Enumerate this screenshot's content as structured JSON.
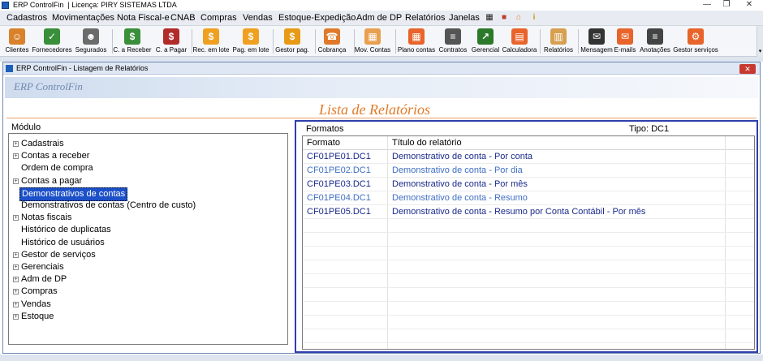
{
  "window": {
    "title": "ERP ControlFin",
    "license": "| Licença: PIRY SISTEMAS LTDA",
    "controls": {
      "minimize": "—",
      "restore": "❐",
      "close": "✕"
    }
  },
  "menu": {
    "items": [
      "Cadastros",
      "Movimentações",
      "Nota Fiscal-e",
      "CNAB",
      "Compras",
      "Vendas",
      "Estoque-Expedição",
      "Adm de DP",
      "Relatórios",
      "Janelas"
    ],
    "icons": [
      "calculator-icon",
      "lock-icon",
      "home-icon",
      "info-icon"
    ]
  },
  "toolbar": {
    "buttons": [
      {
        "label": "Clientes",
        "icon": "clients-icon",
        "color": "#d9822b",
        "glyph": "☺"
      },
      {
        "label": "Fornecedores",
        "icon": "suppliers-icon",
        "color": "#3a8f3a",
        "glyph": "✓"
      },
      {
        "label": "Segurados",
        "icon": "insured-icon",
        "color": "#6b6b6b",
        "glyph": "☻"
      },
      {
        "label": "C. a Receber",
        "icon": "receivable-icon",
        "color": "#3a8f3a",
        "glyph": "$"
      },
      {
        "label": "C. a Pagar",
        "icon": "payable-icon",
        "color": "#b22b2b",
        "glyph": "$"
      },
      {
        "label": "Rec. em lote",
        "icon": "batch-receive-icon",
        "color": "#f0a020",
        "glyph": "$"
      },
      {
        "label": "Pag. em lote",
        "icon": "batch-pay-icon",
        "color": "#f0a020",
        "glyph": "$"
      },
      {
        "label": "Gestor pag.",
        "icon": "payment-manager-icon",
        "color": "#e89a16",
        "glyph": "$"
      },
      {
        "label": "Cobrança",
        "icon": "billing-phone-icon",
        "color": "#e07a2a",
        "glyph": "☎"
      },
      {
        "label": "Mov. Contas",
        "icon": "boxes-icon",
        "color": "#e8a050",
        "glyph": "▦"
      },
      {
        "label": "Plano contas",
        "icon": "chart-of-accounts-icon",
        "color": "#e8642a",
        "glyph": "▦"
      },
      {
        "label": "Contratos",
        "icon": "contracts-icon",
        "color": "#555555",
        "glyph": "≡"
      },
      {
        "label": "Gerencial",
        "icon": "management-chart-icon",
        "color": "#2b7a2b",
        "glyph": "↗"
      },
      {
        "label": "Calculadora",
        "icon": "calculator-icon",
        "color": "#e8642a",
        "glyph": "▤"
      },
      {
        "label": "Relatórios",
        "icon": "reports-icon",
        "color": "#d6a050",
        "glyph": "▥"
      },
      {
        "label": "Mensagem",
        "icon": "message-icon",
        "color": "#333333",
        "glyph": "✉"
      },
      {
        "label": "E-mails",
        "icon": "email-icon",
        "color": "#e8642a",
        "glyph": "✉"
      },
      {
        "label": "Anotações",
        "icon": "notes-icon",
        "color": "#444444",
        "glyph": "≡"
      },
      {
        "label": "Gestor serviços",
        "icon": "services-manager-icon",
        "color": "#e8642a",
        "glyph": "⚙"
      }
    ]
  },
  "child_window": {
    "title": "ERP ControlFin - Listagem de Relatórios",
    "close": "✕",
    "brand": "ERP ControlFin",
    "heading": "Lista de Relatórios"
  },
  "left_panel": {
    "label": "Módulo",
    "expand_glyph": "+",
    "tree": [
      {
        "label": "Cadastrais",
        "expandable": true,
        "selected": false
      },
      {
        "label": "Contas a receber",
        "expandable": true,
        "selected": false
      },
      {
        "label": "Ordem de compra",
        "expandable": false,
        "selected": false
      },
      {
        "label": "Contas a pagar",
        "expandable": true,
        "selected": false
      },
      {
        "label": "Demonstrativos de contas",
        "expandable": false,
        "selected": true
      },
      {
        "label": "Demonstrativos de contas (Centro de custo)",
        "expandable": false,
        "selected": false
      },
      {
        "label": "Notas fiscais",
        "expandable": true,
        "selected": false
      },
      {
        "label": "Histórico de duplicatas",
        "expandable": false,
        "selected": false
      },
      {
        "label": "Histórico de usuários",
        "expandable": false,
        "selected": false
      },
      {
        "label": "Gestor de serviços",
        "expandable": true,
        "selected": false
      },
      {
        "label": "Gerenciais",
        "expandable": true,
        "selected": false
      },
      {
        "label": "Adm de DP",
        "expandable": true,
        "selected": false
      },
      {
        "label": "Compras",
        "expandable": true,
        "selected": false
      },
      {
        "label": "Vendas",
        "expandable": true,
        "selected": false
      },
      {
        "label": "Estoque",
        "expandable": true,
        "selected": false
      }
    ]
  },
  "right_panel": {
    "label": "Formatos",
    "tipo": "Tipo: DC1",
    "columns": [
      "Formato",
      "Título do relatório"
    ],
    "rows": [
      {
        "formato": "CF01PE01.DC1",
        "titulo": "Demonstrativo de conta - Por conta",
        "color": "#1a2a8c"
      },
      {
        "formato": "CF01PE02.DC1",
        "titulo": "Demonstrativo de conta - Por dia",
        "color": "#3f6fc4"
      },
      {
        "formato": "CF01PE03.DC1",
        "titulo": "Demonstrativo de conta - Por mês",
        "color": "#1a2a8c"
      },
      {
        "formato": "CF01PE04.DC1",
        "titulo": "Demonstrativo de conta - Resumo",
        "color": "#3f6fc4"
      },
      {
        "formato": "CF01PE05.DC1",
        "titulo": "Demonstrativo de conta - Resumo por Conta Contábil - Por mês",
        "color": "#1a2a8c"
      }
    ]
  },
  "colors": {
    "accent": "#2f3fad",
    "heading": "#e27a26",
    "selection": "#1c50c8"
  }
}
